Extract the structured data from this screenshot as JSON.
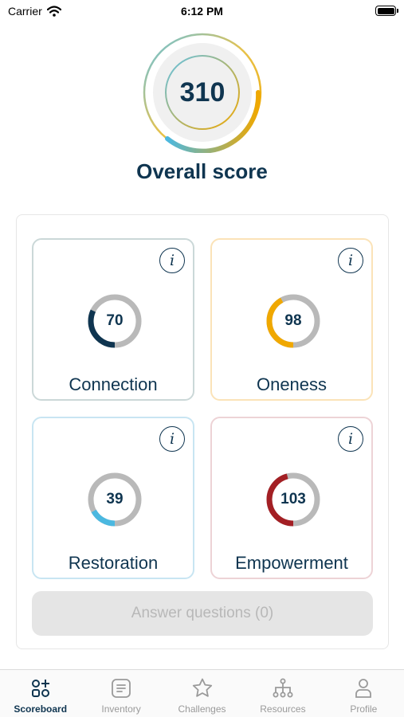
{
  "status_bar": {
    "carrier": "Carrier",
    "time": "6:12 PM"
  },
  "overall": {
    "score": "310",
    "title": "Overall score"
  },
  "categories": [
    {
      "label": "Connection",
      "value": "70",
      "progress": 0.32,
      "color": "#0f3550"
    },
    {
      "label": "Oneness",
      "value": "98",
      "progress": 0.42,
      "color": "#f0a800"
    },
    {
      "label": "Restoration",
      "value": "39",
      "progress": 0.17,
      "color": "#4bb8e0"
    },
    {
      "label": "Empowerment",
      "value": "103",
      "progress": 0.46,
      "color": "#a31f24"
    }
  ],
  "info_glyph": "i",
  "answer_button": {
    "label": "Answer questions (0)"
  },
  "tabs": [
    {
      "label": "Scoreboard",
      "icon": "scoreboard-icon",
      "active": true
    },
    {
      "label": "Inventory",
      "icon": "inventory-icon",
      "active": false
    },
    {
      "label": "Challenges",
      "icon": "star-icon",
      "active": false
    },
    {
      "label": "Resources",
      "icon": "hierarchy-icon",
      "active": false
    },
    {
      "label": "Profile",
      "icon": "profile-icon",
      "active": false
    }
  ]
}
